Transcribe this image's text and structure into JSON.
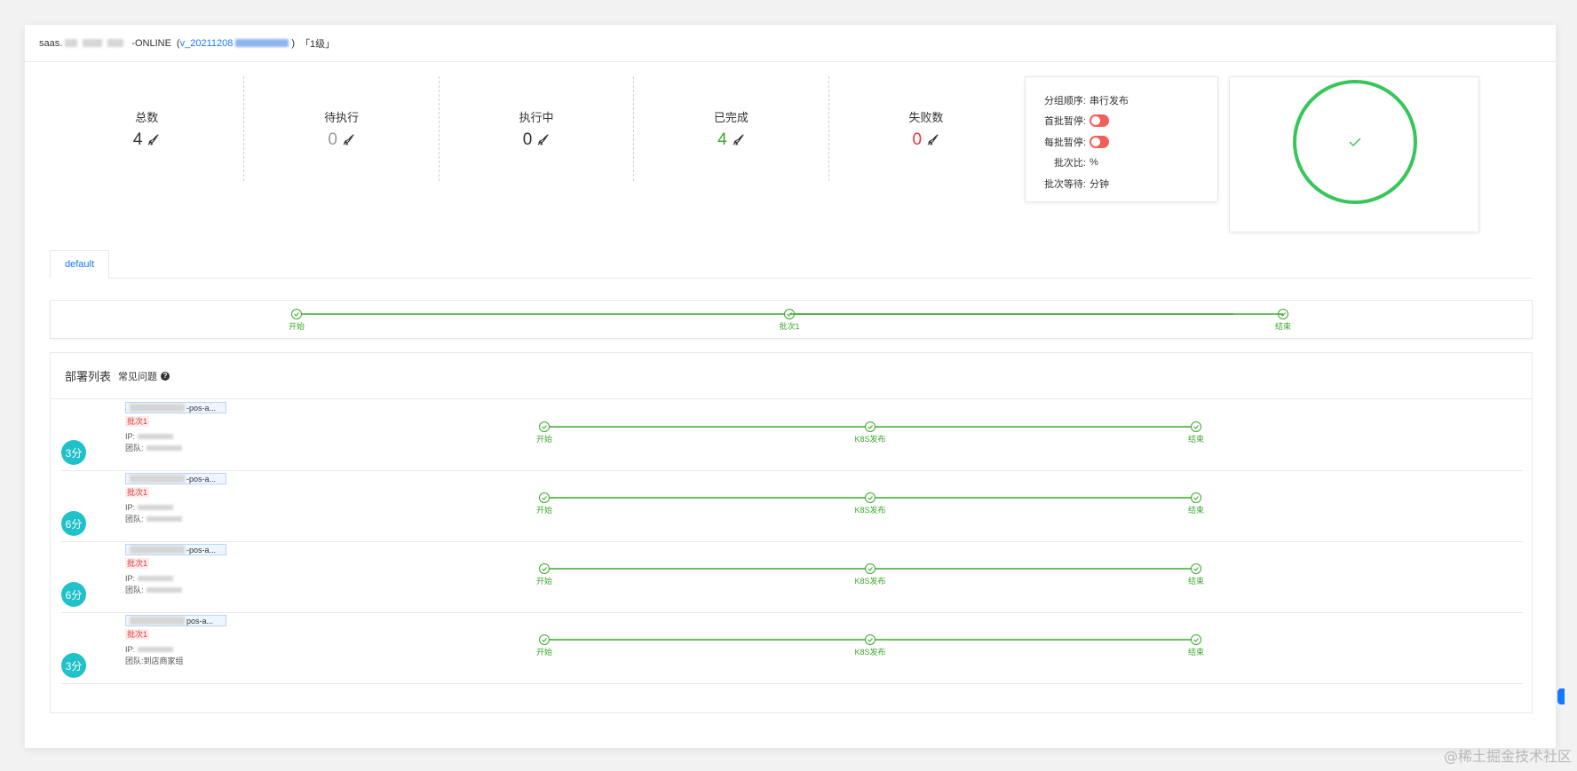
{
  "header": {
    "prefix": "saas.",
    "env": "-ONLINE",
    "open_paren": "(",
    "version": "v_20211208",
    "close_paren": ")",
    "level": "「1级」"
  },
  "stats": [
    {
      "label": "总数",
      "value": "4",
      "color": "#333333"
    },
    {
      "label": "待执行",
      "value": "0",
      "color": "#999999"
    },
    {
      "label": "执行中",
      "value": "0",
      "color": "#333333"
    },
    {
      "label": "已完成",
      "value": "4",
      "color": "#3ba82c"
    },
    {
      "label": "失败数",
      "value": "0",
      "color": "#e4393c"
    }
  ],
  "config": {
    "order_label": "分组顺序:",
    "order_value": "串行发布",
    "first_pause_label": "首批暂停:",
    "each_pause_label": "每批暂停:",
    "ratio_label": "批次比:",
    "ratio_value": "%",
    "wait_label": "批次等待:",
    "wait_value": "分钟"
  },
  "status": {
    "color": "#37c65a",
    "symbol": "✓"
  },
  "tabs": [
    {
      "label": "default"
    }
  ],
  "group_pipeline": [
    "开始",
    "批次1",
    "结束"
  ],
  "deploy": {
    "title": "部署列表",
    "faq": "常见问题",
    "rows": [
      {
        "duration": "3分",
        "name_suffix": "-pos-a...",
        "batch": "批次1",
        "ip_label": "IP:",
        "team_label": "团队:",
        "team_value": "",
        "steps": [
          "开始",
          "K8S发布",
          "结束"
        ]
      },
      {
        "duration": "6分",
        "name_suffix": "-pos-a...",
        "batch": "批次1",
        "ip_label": "IP:",
        "team_label": "团队:",
        "team_value": "",
        "steps": [
          "开始",
          "K8S发布",
          "结束"
        ]
      },
      {
        "duration": "6分",
        "name_suffix": "-pos-a...",
        "batch": "批次1",
        "ip_label": "IP:",
        "team_label": "团队:",
        "team_value": "",
        "steps": [
          "开始",
          "K8S发布",
          "结束"
        ]
      },
      {
        "duration": "3分",
        "name_suffix": "pos-a...",
        "batch": "批次1",
        "ip_label": "IP:",
        "team_label": "团队:",
        "team_value": "到店商家组",
        "steps": [
          "开始",
          "K8S发布",
          "结束"
        ]
      }
    ]
  },
  "watermark": "@稀土掘金技术社区",
  "colors": {
    "step_green": "#3ba82c",
    "accent_blue": "#1677ff",
    "duration_teal": "#20c1c8",
    "toggle_red": "#f0605b"
  }
}
